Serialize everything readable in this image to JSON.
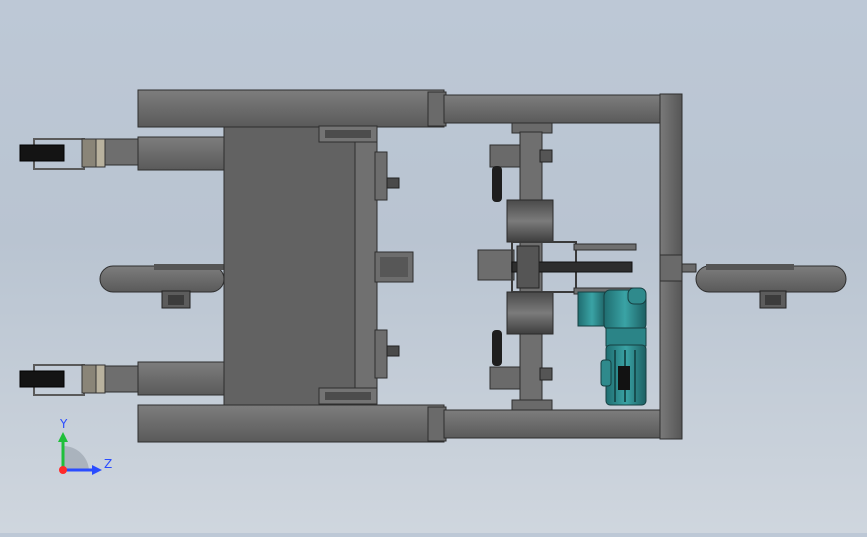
{
  "viewport": {
    "background": "#bfc9d6"
  },
  "model": {
    "frame_color": "#6b6b6b",
    "frame_dark": "#3f3f3f",
    "motor_color": "#2f8a8c",
    "wheel_color": "#2b2b2b"
  },
  "triad": {
    "y_label": "Y",
    "z_label": "Z",
    "y_color": "#1fbf3a",
    "z_color": "#2a4cff",
    "x_color": "#ff2a2a"
  }
}
